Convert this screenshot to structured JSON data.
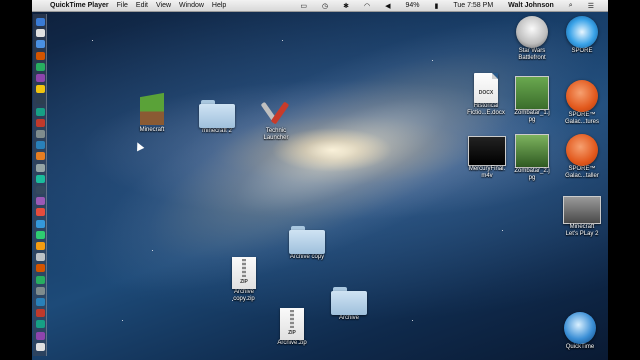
{
  "menubar": {
    "apple": "",
    "app_name": "QuickTime Player",
    "menus": [
      "File",
      "Edit",
      "View",
      "Window",
      "Help"
    ],
    "battery": "94%",
    "clock": "Tue 7:58 PM",
    "user": "Walt Johnson"
  },
  "desktop": {
    "minecraft": "Minecraft",
    "minecraft2": "minecraft 2",
    "technic": [
      "Technic",
      "Launcher"
    ],
    "docx": [
      "Historical",
      "Fictio...E.docx"
    ],
    "docx_tag": "DOCX",
    "zombatar1": [
      "Zombatar_1.j",
      "pg"
    ],
    "zombatar2": [
      "Zombatar_2.j",
      "pg"
    ],
    "mercury": [
      "MercuryFinal.",
      "m4v"
    ],
    "starwars": [
      "Star Wars",
      "Battlefront"
    ],
    "spore": "SPORE",
    "spore_tures": [
      "SPORE™",
      "Galac...tures"
    ],
    "spore_taller": [
      "SPORE™",
      "Galac...taller"
    ],
    "mc_letsplay": [
      "Minecraft",
      "Let's PLay 2"
    ],
    "archive_copy": "Archive copy",
    "archive_copy_zip": [
      "Archive",
      "copy.zip"
    ],
    "archive_zip": "Archive.zip",
    "archive": "Archive",
    "zip_tag": "ZIP",
    "quicktime": "QuickTime"
  },
  "colors": {
    "accent_orange": "#e2581c",
    "folder_blue": "#b7d3ea"
  }
}
